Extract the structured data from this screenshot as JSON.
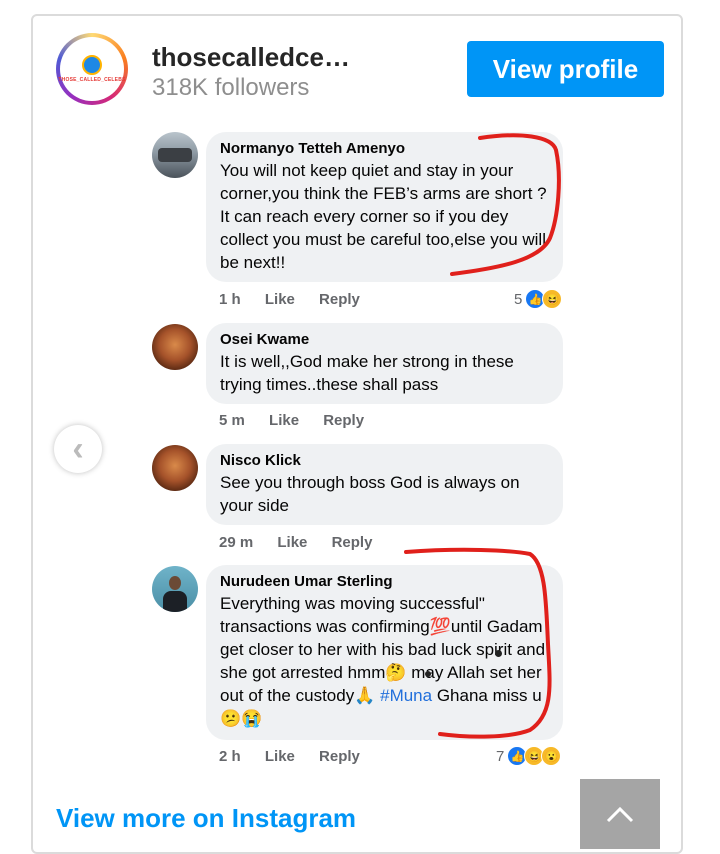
{
  "profile": {
    "username": "thosecalledce…",
    "followers": "318K followers",
    "view_profile_label": "View profile",
    "avatar_logo_text": "THOSE_CALLED_CELEBS"
  },
  "comments": [
    {
      "author": "Normanyo Tetteh Amenyo",
      "text": "You will not keep quiet and stay in your corner,you think the FEB’s arms are short ? It can reach every corner so if you dey collect you must be careful too,else you will be next!!",
      "time": "1 h",
      "like_label": "Like",
      "reply_label": "Reply",
      "reaction_count": "5",
      "reaction_icons": [
        "like",
        "haha"
      ]
    },
    {
      "author": "Osei Kwame",
      "text": "It is well,,God make her strong in these trying times..these shall pass",
      "time": "5 m",
      "like_label": "Like",
      "reply_label": "Reply"
    },
    {
      "author": "Nisco Klick",
      "text": "See you through boss God is always on your side",
      "time": "29 m",
      "like_label": "Like",
      "reply_label": "Reply"
    },
    {
      "author": "Nurudeen Umar Sterling",
      "text_main": "Everything was moving successful\" transactions was confirming💯until Gadam get closer to her with his bad luck spirit and she got arrested hmm🤔 may Allah set her out of the custody🙏",
      "hashtag": "#Muna",
      "text_end": "Ghana miss u 😕😭",
      "time": "2 h",
      "like_label": "Like",
      "reply_label": "Reply",
      "reaction_count": "7",
      "reaction_icons": [
        "like",
        "haha",
        "wow"
      ]
    }
  ],
  "footer": {
    "view_more": "View more on Instagram"
  },
  "colors": {
    "instagram_blue": "#0095f6",
    "facebook_blue": "#1877f2",
    "annotation_red": "#e0201b"
  }
}
